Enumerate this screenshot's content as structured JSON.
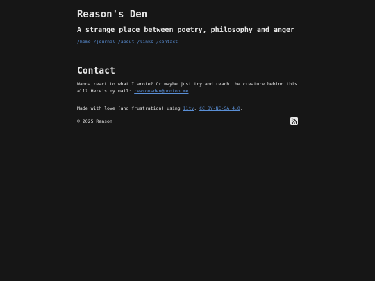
{
  "header": {
    "title": "Reason's Den",
    "tagline": "A strange place between poetry, philosophy and anger",
    "nav": [
      {
        "label": "/home"
      },
      {
        "label": "/journal"
      },
      {
        "label": "/about"
      },
      {
        "label": "/links"
      },
      {
        "label": "/contact"
      }
    ]
  },
  "main": {
    "title": "Contact",
    "text": "Wanna react to what I wrote? Or maybe just try and reach the creature behind this all? Here's my mail: ",
    "email": "reasonsden@proton.me"
  },
  "footer": {
    "made_with_prefix": "Made with love (and frustration) using ",
    "eleventy": "11ty",
    "sep": ", ",
    "license": "CC BY-NC-SA 4.0",
    "end": ".",
    "copyright": "© 2025 Reason",
    "rss_icon": "rss-icon"
  },
  "colors": {
    "background": "#161616",
    "text": "#e6e6e6",
    "link": "#5a8fd6"
  }
}
